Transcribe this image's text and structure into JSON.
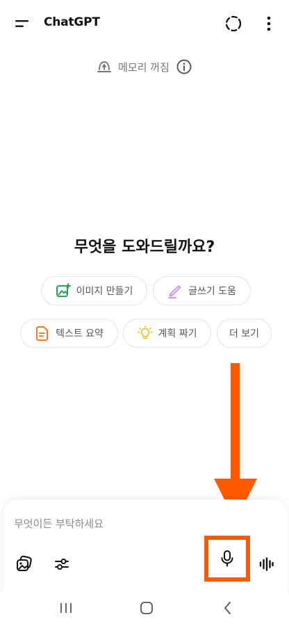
{
  "header": {
    "title": "ChatGPT"
  },
  "memory": {
    "status": "메모리 꺼짐"
  },
  "headline": "무엇을 도와드릴까요?",
  "suggestions": [
    {
      "label": "이미지 만들기"
    },
    {
      "label": "글쓰기 도움"
    },
    {
      "label": "텍스트 요약"
    },
    {
      "label": "계획 짜기"
    },
    {
      "label": "더 보기"
    }
  ],
  "composer": {
    "placeholder": "무엇이든 부탁하세요"
  },
  "colors": {
    "annotation": "#ff5a00",
    "image_icon": "#2e9e5b",
    "writing_icon": "#c79ae0",
    "summary_icon": "#f07a2a",
    "plan_icon": "#e8c233"
  }
}
